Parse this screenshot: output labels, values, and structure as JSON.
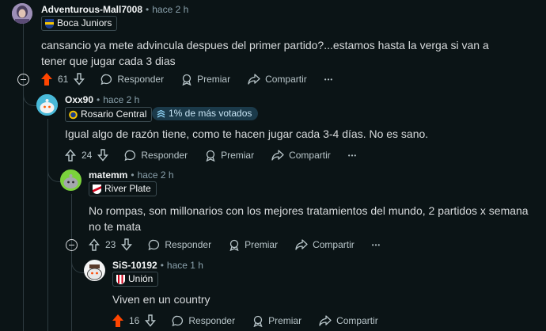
{
  "comments": [
    {
      "username": "Adventurous-Mall7008",
      "separator": "•",
      "time": "hace 2 h",
      "flair": "Boca Juniors",
      "body": "cansancio ya mete advincula despues del primer partido?...estamos hasta la verga si van a tener que jugar cada 3 dias",
      "score": "61",
      "upvoted": true,
      "reply_label": "Responder",
      "award_label": "Premiar",
      "share_label": "Compartir",
      "more_label": "•••"
    },
    {
      "username": "Oxx90",
      "separator": "•",
      "time": "hace 2 h",
      "flair": "Rosario Central",
      "badge": "1% de más votados",
      "body": "Igual algo de razón tiene, como te hacen jugar cada 3-4 días. No es sano.",
      "score": "24",
      "upvoted": false,
      "reply_label": "Responder",
      "award_label": "Premiar",
      "share_label": "Compartir",
      "more_label": "•••"
    },
    {
      "username": "matemm",
      "separator": "•",
      "time": "hace 2 h",
      "flair": "River Plate",
      "body": "No rompas, son millonarios con los mejores tratamientos del mundo, 2 partidos x semana no te mata",
      "score": "23",
      "upvoted": false,
      "reply_label": "Responder",
      "award_label": "Premiar",
      "share_label": "Compartir",
      "more_label": "•••"
    },
    {
      "username": "SiS-10192",
      "separator": "•",
      "time": "hace 1 h",
      "flair": "Unión",
      "body": "Viven en un country",
      "score": "16",
      "upvoted": true,
      "reply_label": "Responder",
      "award_label": "Premiar",
      "share_label": "Compartir",
      "more_label": ""
    }
  ],
  "colors": {
    "upvote": "#ff4500",
    "background": "#0b1416",
    "badge_bg": "#1b3a4a",
    "time": "#8ba2ad"
  },
  "icons": [
    "collapse-icon",
    "upvote-icon",
    "downvote-icon",
    "reply-icon",
    "award-icon",
    "share-icon",
    "more-icon",
    "top-percent-icon"
  ]
}
